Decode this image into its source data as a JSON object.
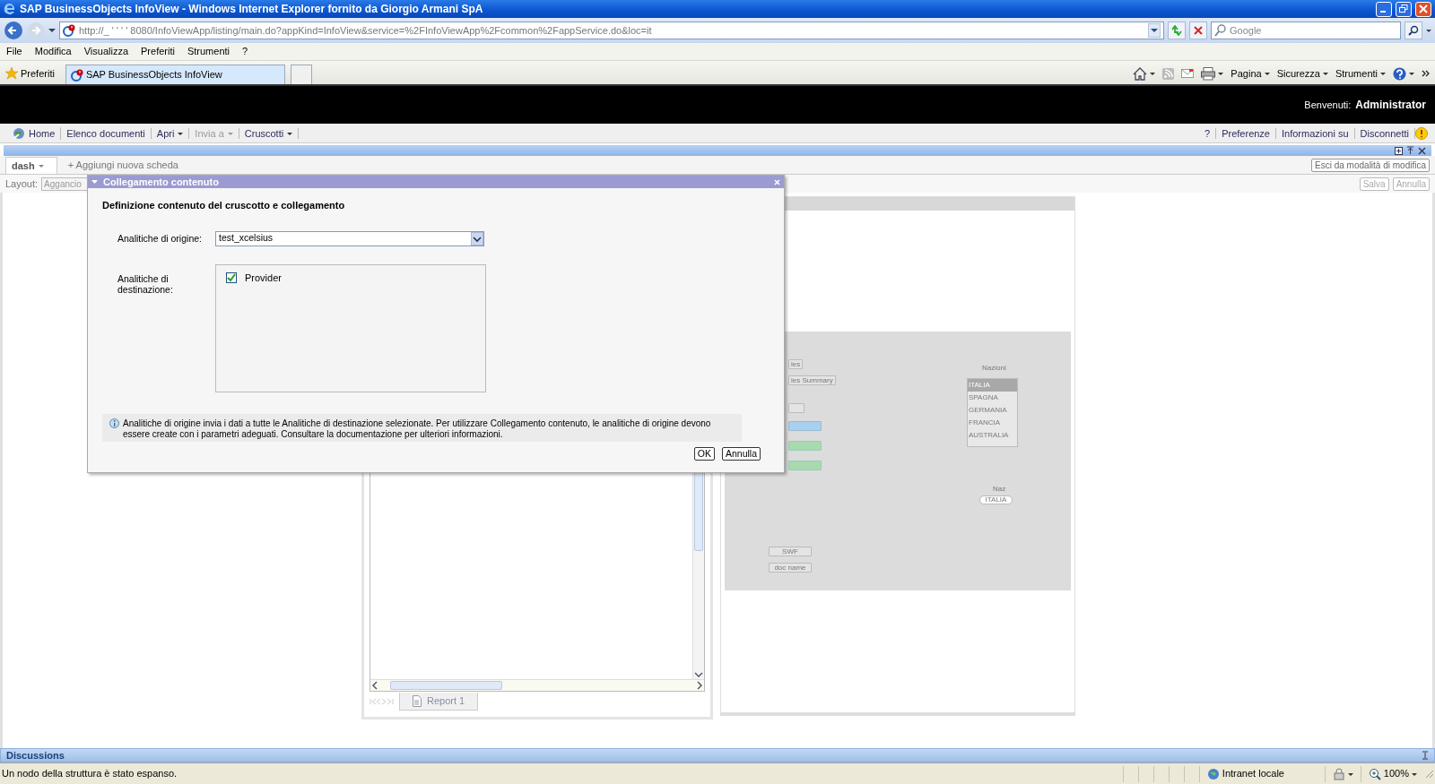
{
  "window": {
    "title": "SAP BusinessObjects InfoView - Windows Internet Explorer fornito da Giorgio Armani SpA",
    "address": "http://_  ' ' ' ' 8080/InfoViewApp/listing/main.do?appKind=InfoView&service=%2FInfoViewApp%2Fcommon%2FappService.do&loc=it",
    "search_placeholder": "Google"
  },
  "menu": [
    "File",
    "Modifica",
    "Visualizza",
    "Preferiti",
    "Strumenti",
    "?"
  ],
  "favorites": {
    "label": "Preferiti"
  },
  "browser_tabs": [
    {
      "label": "SAP BusinessObjects InfoView",
      "selected": true
    }
  ],
  "command_bar": [
    "Pagina",
    "Sicurezza",
    "Strumenti"
  ],
  "header": {
    "welcome": "Benvenuti:",
    "user": "Administrator"
  },
  "nav": {
    "left": [
      {
        "label": "Home",
        "disabled": false,
        "dropdown": false
      },
      {
        "label": "Elenco documenti",
        "disabled": false,
        "dropdown": false
      },
      {
        "label": "Apri",
        "disabled": false,
        "dropdown": true
      },
      {
        "label": "Invia a",
        "disabled": true,
        "dropdown": true
      },
      {
        "label": "Cruscotti",
        "disabled": false,
        "dropdown": true
      }
    ],
    "right": [
      "?",
      "Preferenze",
      "Informazioni su",
      "Disconnetti"
    ]
  },
  "dashboard_tabs": [
    {
      "label": "dash",
      "selected": true
    }
  ],
  "add_tab": "+ Aggiungi nuova scheda",
  "exit_edit": "Esci da modalità di modifica",
  "layout": {
    "label": "Layout:",
    "value": "Aggancio"
  },
  "actions": [
    {
      "label": "Salva",
      "disabled": true
    },
    {
      "label": "Annulla",
      "disabled": true
    }
  ],
  "dialog": {
    "title": "Collegamento contenuto",
    "heading": "Definizione contenuto del cruscotto e collegamento",
    "source_label": "Analitiche di origine:",
    "source_value": "test_xcelsius",
    "target_label": "Analitiche di destinazione:",
    "targets": [
      {
        "label": "Provider",
        "checked": true
      }
    ],
    "info": "Analitiche di origine invia i dati a tutte le Analitiche di destinazione selezionate. Per utilizzare Collegamento contenuto, le analitiche di origine devono essere create con i parametri adeguati. Consultare la documentazione per ulteriori informazioni.",
    "buttons": [
      "OK",
      "Annulla"
    ]
  },
  "report": {
    "tab": "Report 1"
  },
  "canvas": {
    "buttons": [
      {
        "kind": "plain",
        "label": "les"
      },
      {
        "kind": "plain",
        "label": "les Summary"
      },
      {
        "kind": "plain"
      },
      {
        "kind": "blue"
      },
      {
        "kind": "green"
      },
      {
        "kind": "green"
      }
    ],
    "list_title": "Nazioni",
    "list": [
      {
        "label": "ITALIA",
        "selected": true
      },
      {
        "label": "SPAGNA",
        "selected": false
      },
      {
        "label": "GERMANIA",
        "selected": false
      },
      {
        "label": "FRANCIA",
        "selected": false
      },
      {
        "label": "AUSTRALIA",
        "selected": false
      }
    ],
    "combo_title": "Naz",
    "combo_value": "ITALIA",
    "bottom_buttons": [
      "SWF",
      "doc name"
    ]
  },
  "discussions": "Discussions",
  "status_bar": {
    "message": "Un nodo della struttura è stato espanso.",
    "zone": "Intranet locale",
    "zoom": "100%"
  }
}
